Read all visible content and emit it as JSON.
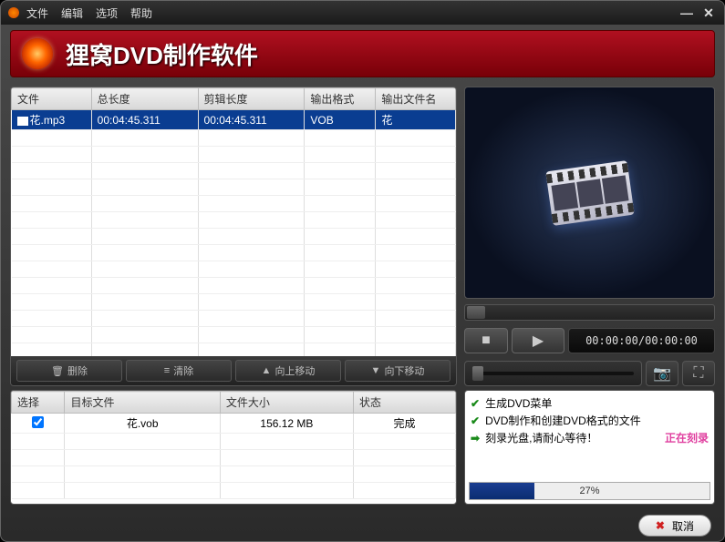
{
  "menu": {
    "file": "文件",
    "edit": "编辑",
    "options": "选项",
    "help": "帮助"
  },
  "banner": {
    "title": "狸窝DVD制作软件"
  },
  "fileTable": {
    "headers": {
      "file": "文件",
      "totalLen": "总长度",
      "clipLen": "剪辑长度",
      "outFmt": "输出格式",
      "outName": "输出文件名"
    },
    "row": {
      "file": "花.mp3",
      "totalLen": "00:04:45.311",
      "clipLen": "00:04:45.311",
      "outFmt": "VOB",
      "outName": "花"
    }
  },
  "toolbar": {
    "delete": "删除",
    "clear": "清除",
    "moveUp": "向上移动",
    "moveDown": "向下移动"
  },
  "preview": {
    "time": "00:00:00/00:00:00"
  },
  "outTable": {
    "headers": {
      "select": "选择",
      "target": "目标文件",
      "size": "文件大小",
      "status": "状态"
    },
    "row": {
      "target": "花.vob",
      "size": "156.12 MB",
      "status": "完成"
    }
  },
  "statusBox": {
    "line1": "生成DVD菜单",
    "line2": "DVD制作和创建DVD格式的文件",
    "line3": "刻录光盘,请耐心等待！",
    "line3status": "正在刻录",
    "progressText": "27%"
  },
  "footer": {
    "cancel": "取消"
  }
}
